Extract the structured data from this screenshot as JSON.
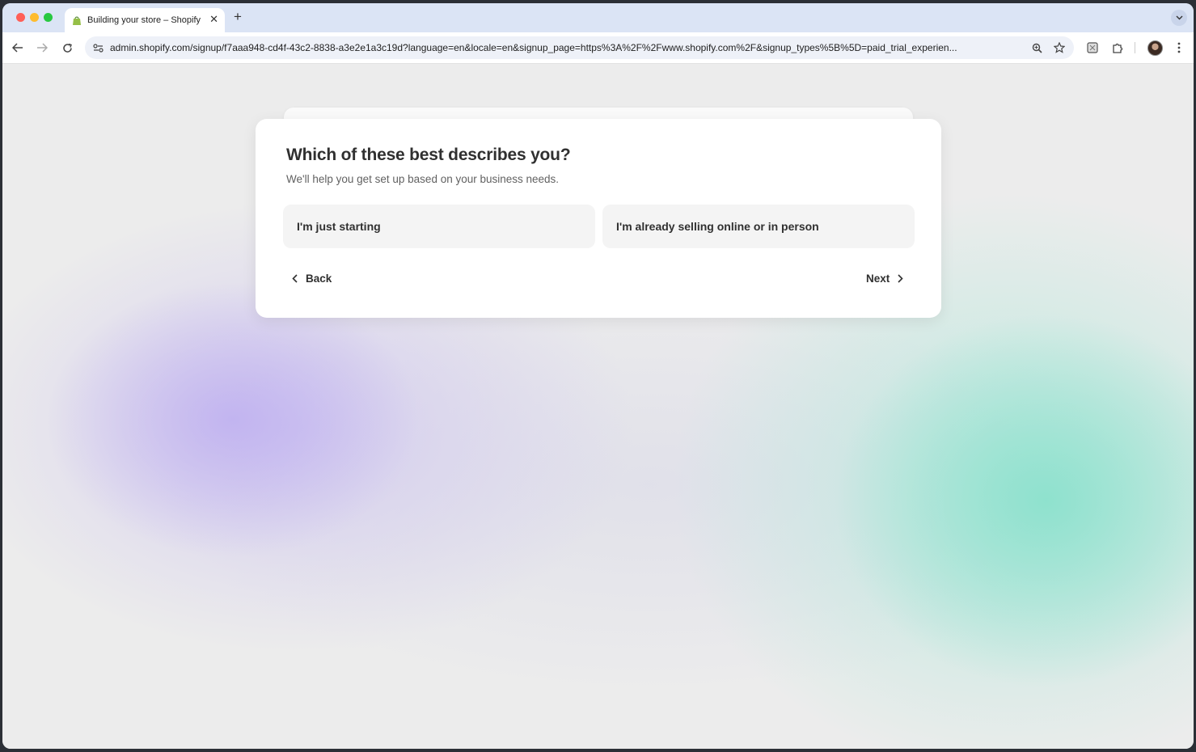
{
  "browser": {
    "tab": {
      "title": "Building your store – Shopify",
      "close": "✕"
    },
    "new_tab": "+",
    "address_bar": {
      "host": "admin.shopify.com",
      "path": "/signup/f7aaa948-cd4f-43c2-8838-a3e2e1a3c19d?language=en&locale=en&signup_page=https%3A%2F%2Fwww.shopify.com%2F&signup_types%5B%5D=paid_trial_experien..."
    },
    "icons": [
      "back-arrow-icon",
      "forward-arrow-icon",
      "reload-icon",
      "site-settings-icon",
      "zoom-icon",
      "bookmark-star-icon",
      "extension-icon",
      "puzzle-icon",
      "profile-avatar",
      "kebab-menu-icon"
    ]
  },
  "onboarding": {
    "title": "Which of these best describes you?",
    "subtitle": "We'll help you get set up based on your business needs.",
    "options": [
      {
        "label": "I'm just starting"
      },
      {
        "label": "I'm already selling online or in person"
      }
    ],
    "back_label": "Back",
    "next_label": "Next"
  },
  "colors": {
    "card": "#ffffff",
    "option_bg": "#f4f4f4",
    "text": "#303030",
    "purple_glow": "#beaff0",
    "teal_glow": "#8ce1cd"
  }
}
